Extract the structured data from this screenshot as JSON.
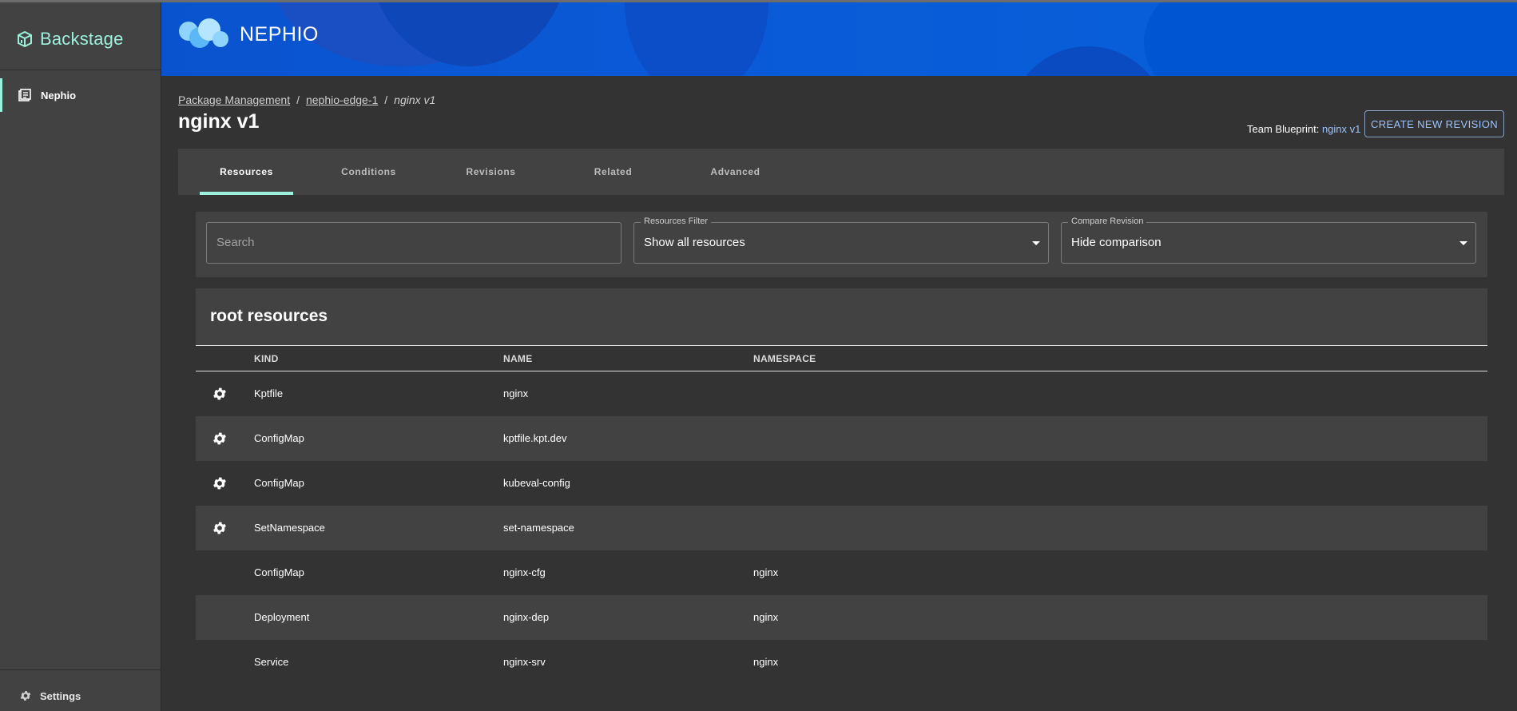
{
  "sidebar": {
    "brand": "Backstage",
    "items": [
      {
        "label": "Nephio",
        "icon": "library-books-icon"
      }
    ],
    "settings_label": "Settings"
  },
  "banner": {
    "logo_text": "NEPHIO"
  },
  "breadcrumb": {
    "items": [
      "Package Management",
      "nephio-edge-1"
    ],
    "separator": "/",
    "current": "nginx v1"
  },
  "page": {
    "title": "nginx v1",
    "team_blueprint_label": "Team Blueprint:",
    "team_blueprint_value": "nginx v1",
    "create_button": "CREATE NEW REVISION"
  },
  "tabs": [
    {
      "label": "Resources",
      "active": true
    },
    {
      "label": "Conditions",
      "active": false
    },
    {
      "label": "Revisions",
      "active": false
    },
    {
      "label": "Related",
      "active": false
    },
    {
      "label": "Advanced",
      "active": false
    }
  ],
  "filters": {
    "search_placeholder": "Search",
    "resources_filter_label": "Resources Filter",
    "resources_filter_value": "Show all resources",
    "compare_label": "Compare Revision",
    "compare_value": "Hide comparison"
  },
  "resources": {
    "title": "root resources",
    "columns": [
      "KIND",
      "NAME",
      "NAMESPACE"
    ],
    "rows": [
      {
        "kind": "Kptfile",
        "name": "nginx",
        "namespace": "",
        "icon": "gear-icon"
      },
      {
        "kind": "ConfigMap",
        "name": "kptfile.kpt.dev",
        "namespace": "",
        "icon": "gear-icon"
      },
      {
        "kind": "ConfigMap",
        "name": "kubeval-config",
        "namespace": "",
        "icon": "gear-icon"
      },
      {
        "kind": "SetNamespace",
        "name": "set-namespace",
        "namespace": "",
        "icon": "gear-icon"
      },
      {
        "kind": "ConfigMap",
        "name": "nginx-cfg",
        "namespace": "nginx",
        "icon": ""
      },
      {
        "kind": "Deployment",
        "name": "nginx-dep",
        "namespace": "nginx",
        "icon": ""
      },
      {
        "kind": "Service",
        "name": "nginx-srv",
        "namespace": "nginx",
        "icon": ""
      }
    ]
  },
  "colors": {
    "accent": "#9cf0dc",
    "link": "#9cc4ff",
    "banner": "#0b5ad7",
    "background": "#333333",
    "surface": "#424242"
  }
}
